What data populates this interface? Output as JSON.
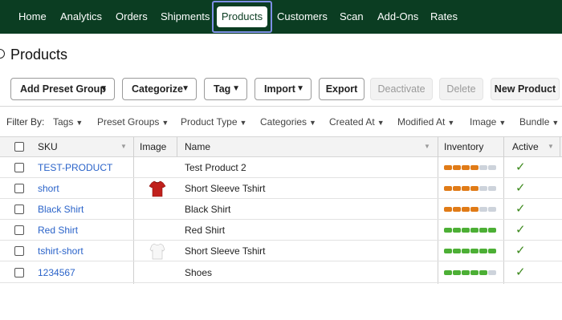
{
  "nav": {
    "items": [
      "Home",
      "Analytics",
      "Orders",
      "Shipments",
      "Products",
      "Customers",
      "Scan",
      "Add-Ons",
      "Rates"
    ],
    "active": "Products"
  },
  "page": {
    "title": "Products"
  },
  "toolbar": {
    "add_preset_group": "Add Preset Group",
    "categorize": "Categorize",
    "tag": "Tag",
    "import": "Import",
    "export": "Export",
    "deactivate": "Deactivate",
    "delete": "Delete",
    "new_product": "New Product"
  },
  "filters": {
    "label": "Filter By:",
    "items": [
      "Tags",
      "Preset Groups",
      "Product Type",
      "Categories",
      "Created At",
      "Modified At",
      "Image",
      "Bundle"
    ]
  },
  "table": {
    "columns": {
      "sku": "SKU",
      "image": "Image",
      "name": "Name",
      "inventory": "Inventory",
      "active": "Active"
    },
    "rows": [
      {
        "sku": "TEST-PRODUCT",
        "name": "Test Product 2",
        "image": "",
        "inventory_level": 0.6,
        "inventory_color": "#e07b17",
        "active": true
      },
      {
        "sku": "short",
        "name": "Short Sleeve Tshirt",
        "image": "red-tshirt",
        "inventory_level": 0.6,
        "inventory_color": "#e07b17",
        "active": true
      },
      {
        "sku": "Black Shirt",
        "name": "Black Shirt",
        "image": "",
        "inventory_level": 0.6,
        "inventory_color": "#e07b17",
        "active": true
      },
      {
        "sku": "Red Shirt",
        "name": "Red Shirt",
        "image": "",
        "inventory_level": 1.0,
        "inventory_color": "#4caf35",
        "active": true
      },
      {
        "sku": "tshirt-short",
        "name": "Short Sleeve Tshirt",
        "image": "white-tshirt",
        "inventory_level": 1.0,
        "inventory_color": "#4caf35",
        "active": true
      },
      {
        "sku": "1234567",
        "name": "Shoes",
        "image": "",
        "inventory_level": 0.8,
        "inventory_color": "#4caf35",
        "active": true
      }
    ]
  },
  "colors": {
    "nav_bg": "#0b3d22",
    "link": "#2a63c9",
    "active_check": "#3d8a1e",
    "inventory_empty": "#cdd3db"
  }
}
